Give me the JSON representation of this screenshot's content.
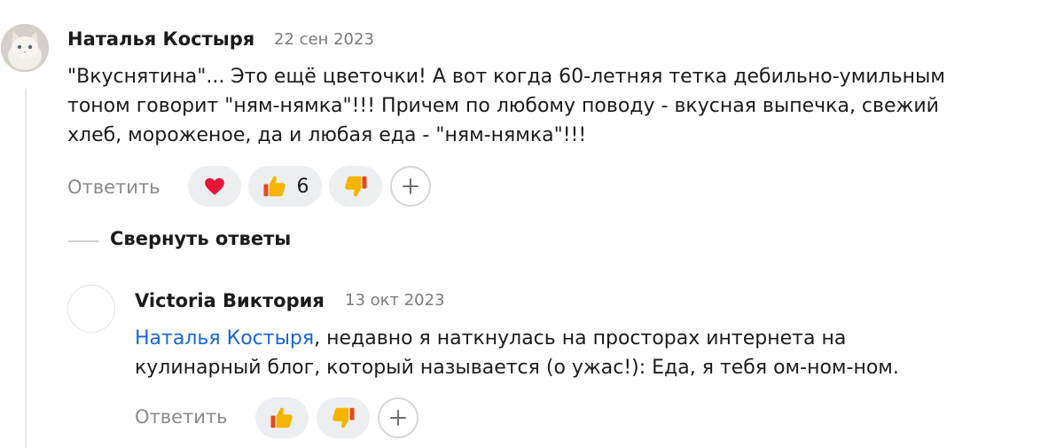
{
  "comment": {
    "author": "Наталья Костыря",
    "date": "22 сен 2023",
    "text_lines": [
      "\"Вкуснятина\"... Это ещё цветочки! А вот когда 60-летняя тетка дебильно-умильным",
      "тоном говорит \"ням-нямка\"!!! Причем по любому поводу - вкусная выпечка, свежий",
      "хлеб, мороженое, да и любая еда - \"ням-нямка\"!!!"
    ],
    "reply_label": "Ответить",
    "reactions": [
      {
        "icon": "heart-icon"
      },
      {
        "icon": "thumbs-up-icon",
        "count": "6"
      },
      {
        "icon": "thumbs-down-icon"
      }
    ],
    "add_reaction_icon": "plus-icon"
  },
  "collapse_label": "Свернуть ответы",
  "reply": {
    "author": "Victoria Виктория",
    "date": "13 окт 2023",
    "mention": "Наталья Костыря",
    "text_line1_rest": ", недавно я наткнулась на просторах интернета на",
    "text_line2": "кулинарный блог, который называется (о ужас!): Еда, я тебя ом-ном-ном.",
    "reply_label": "Ответить",
    "reactions": [
      {
        "icon": "thumbs-up-icon"
      },
      {
        "icon": "thumbs-down-icon"
      }
    ],
    "add_reaction_icon": "plus-icon"
  },
  "colors": {
    "mention": "#1a66d8",
    "heart": "#e8173a",
    "thumb": "#f4b400",
    "pill_bg": "#eceef1"
  }
}
